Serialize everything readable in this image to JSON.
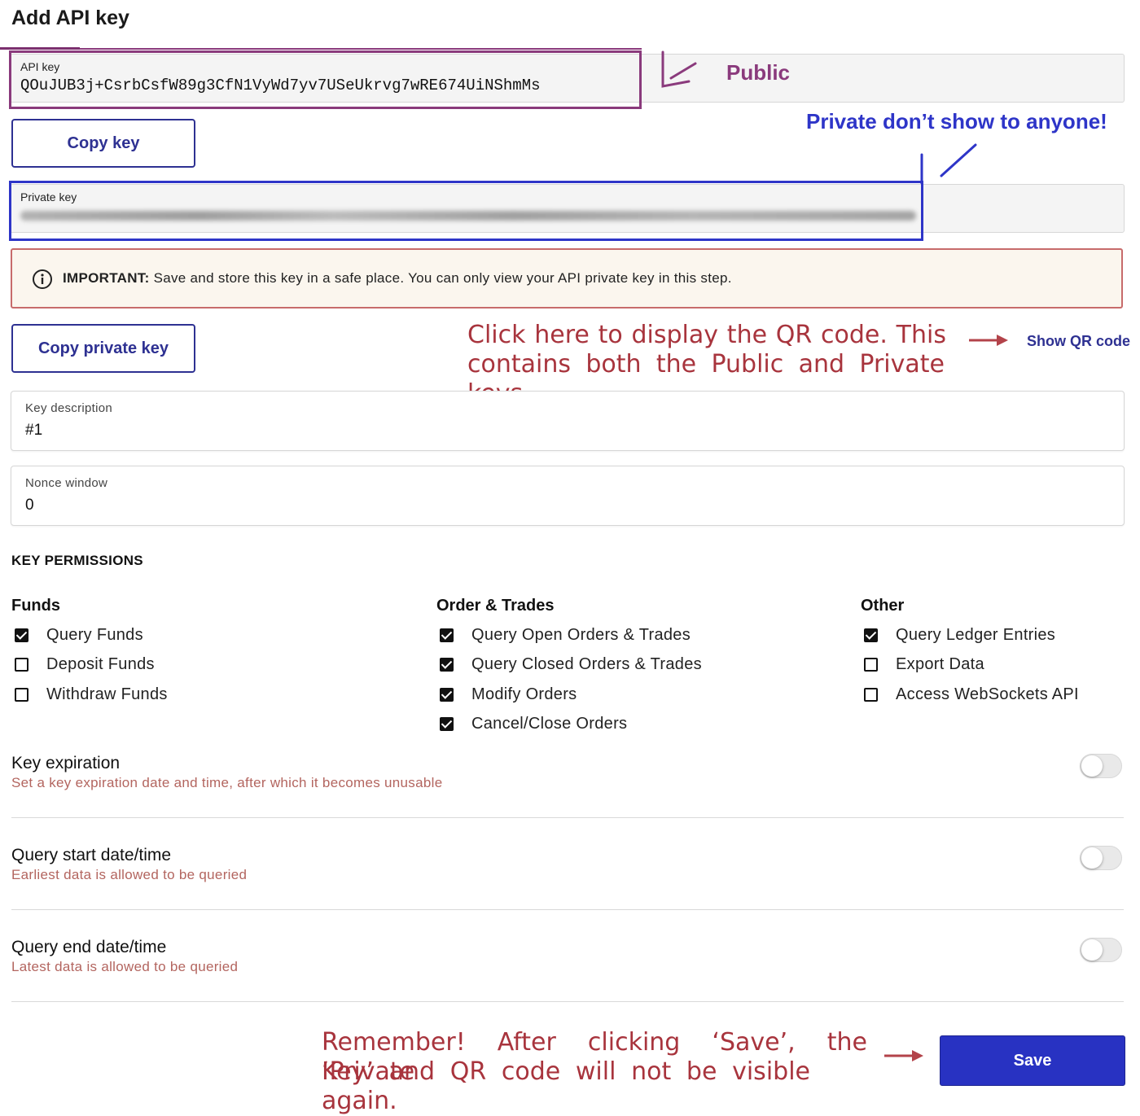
{
  "header": {
    "title": "Add API key"
  },
  "api_key": {
    "label": "API key",
    "value": "QOuJUB3j+CsrbCsfW89g3CfN1VyWd7yv7USeUkrvg7wRE674UiNShmMs",
    "copy_label": "Copy key"
  },
  "private_key": {
    "label": "Private key",
    "copy_label": "Copy private key"
  },
  "notice": {
    "strong": "IMPORTANT:",
    "text": " Save and store this key in a safe place. You can only view your API private key in this step."
  },
  "annotations": {
    "public": "Public",
    "private_warning": "Private don’t show to anyone!",
    "qr_line1": "Click here to display the QR code. This",
    "qr_line2": "contains both the Public and Private keys.",
    "save_line1": "Remember! After clicking ‘Save’, the ‘Private",
    "save_line2": "Key’ and QR code will not be visible again."
  },
  "qr": {
    "link_label": "Show QR code"
  },
  "description": {
    "label": "Key description",
    "value": "#1"
  },
  "nonce": {
    "label": "Nonce window",
    "value": "0"
  },
  "permissions": {
    "heading": "KEY PERMISSIONS",
    "groups": [
      {
        "title": "Funds",
        "items": [
          {
            "label": "Query Funds",
            "checked": true
          },
          {
            "label": "Deposit Funds",
            "checked": false
          },
          {
            "label": "Withdraw Funds",
            "checked": false
          }
        ]
      },
      {
        "title": "Order & Trades",
        "items": [
          {
            "label": "Query Open Orders & Trades",
            "checked": true
          },
          {
            "label": "Query Closed Orders & Trades",
            "checked": true
          },
          {
            "label": "Modify Orders",
            "checked": true
          },
          {
            "label": "Cancel/Close Orders",
            "checked": true
          }
        ]
      },
      {
        "title": "Other",
        "items": [
          {
            "label": "Query Ledger Entries",
            "checked": true
          },
          {
            "label": "Export Data",
            "checked": false
          },
          {
            "label": "Access WebSockets API",
            "checked": false
          }
        ]
      }
    ]
  },
  "settings": [
    {
      "title": "Key expiration",
      "desc": "Set a key expiration date and time, after which it becomes unusable",
      "enabled": false
    },
    {
      "title": "Query start date/time",
      "desc": "Earliest data is allowed to be queried",
      "enabled": false
    },
    {
      "title": "Query end date/time",
      "desc": "Latest data is allowed to be queried",
      "enabled": false
    }
  ],
  "footer": {
    "save_label": "Save"
  },
  "colors": {
    "primary": "#2832c2",
    "annotation_red": "#a8343d",
    "annotation_purple": "#8a3a7c",
    "annotation_blue": "#2e35c8"
  }
}
